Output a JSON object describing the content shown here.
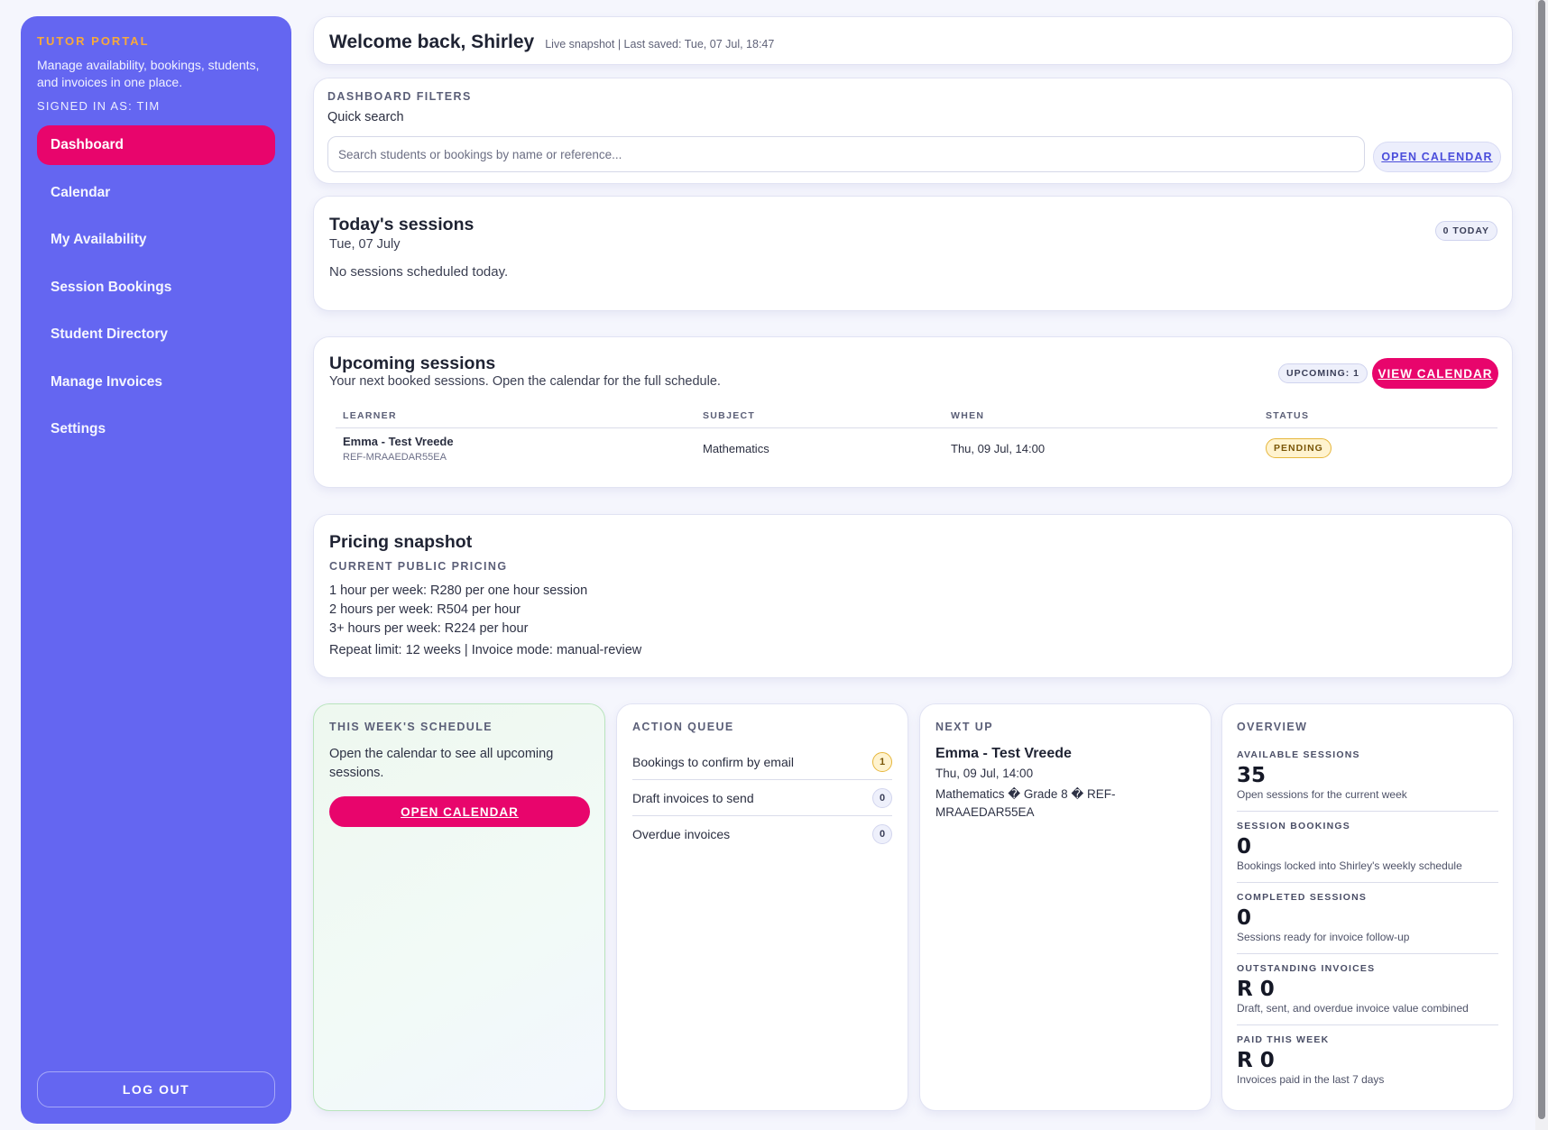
{
  "sidebar": {
    "brand": "TUTOR PORTAL",
    "tagline": "Manage availability, bookings, students, and invoices in one place.",
    "signed_in": "SIGNED IN AS: TIM",
    "items": [
      {
        "label": "Dashboard",
        "active": true
      },
      {
        "label": "Calendar"
      },
      {
        "label": "My Availability"
      },
      {
        "label": "Session Bookings"
      },
      {
        "label": "Student Directory"
      },
      {
        "label": "Manage Invoices"
      },
      {
        "label": "Settings"
      }
    ],
    "logout_label": "LOG OUT"
  },
  "header": {
    "title": "Welcome back, Shirley",
    "meta": "Live snapshot | Last saved: Tue, 07 Jul, 18:47"
  },
  "filters": {
    "label": "DASHBOARD FILTERS",
    "quick_search_label": "Quick search",
    "search_placeholder": "Search students or bookings by name or reference...",
    "open_calendar_label": "OPEN CALENDAR"
  },
  "today": {
    "title": "Today's sessions",
    "date": "Tue, 07 July",
    "badge": "0 TODAY",
    "empty_text": "No sessions scheduled today."
  },
  "upcoming": {
    "title": "Upcoming sessions",
    "subtitle": "Your next booked sessions. Open the calendar for the full schedule.",
    "badge": "UPCOMING: 1",
    "view_calendar_label": "VIEW CALENDAR",
    "columns": [
      "LEARNER",
      "SUBJECT",
      "WHEN",
      "STATUS"
    ],
    "rows": [
      {
        "learner": "Emma - Test Vreede",
        "ref": "REF-MRAAEDAR55EA",
        "subject": "Mathematics",
        "when": "Thu, 09 Jul, 14:00",
        "status": "PENDING"
      }
    ]
  },
  "pricing": {
    "title": "Pricing snapshot",
    "label": "CURRENT PUBLIC PRICING",
    "lines": [
      "1 hour per week: R280 per one hour session",
      "2 hours per week: R504 per hour",
      "3+ hours per week: R224 per hour"
    ],
    "repeat": "Repeat limit: 12 weeks | Invoice mode: manual-review"
  },
  "schedule": {
    "label": "THIS WEEK'S SCHEDULE",
    "description": "Open the calendar to see all upcoming sessions.",
    "button_label": "OPEN CALENDAR"
  },
  "queue": {
    "label": "ACTION QUEUE",
    "items": [
      {
        "label": "Bookings to confirm by email",
        "count": "1"
      },
      {
        "label": "Draft invoices to send",
        "count": "0"
      },
      {
        "label": "Overdue invoices",
        "count": "0"
      }
    ]
  },
  "next_up": {
    "label": "NEXT UP",
    "name": "Emma - Test Vreede",
    "when": "Thu, 09 Jul, 14:00",
    "detail": "Mathematics � Grade 8 � REF-MRAAEDAR55EA"
  },
  "overview": {
    "label": "OVERVIEW",
    "items": [
      {
        "label": "AVAILABLE SESSIONS",
        "value": "35",
        "desc": "Open sessions for the current week"
      },
      {
        "label": "SESSION BOOKINGS",
        "value": "0",
        "desc": "Bookings locked into Shirley's weekly schedule"
      },
      {
        "label": "COMPLETED SESSIONS",
        "value": "0",
        "desc": "Sessions ready for invoice follow-up"
      },
      {
        "label": "OUTSTANDING INVOICES",
        "value": "R 0",
        "desc": "Draft, sent, and overdue invoice value combined"
      },
      {
        "label": "PAID THIS WEEK",
        "value": "R 0",
        "desc": "Invoices paid in the last 7 days"
      }
    ]
  },
  "colors": {
    "sidebar": "#6466f1",
    "accent_pink": "#e8056c",
    "brand_orange": "#f7a93b",
    "pending": "#fff3cf"
  }
}
